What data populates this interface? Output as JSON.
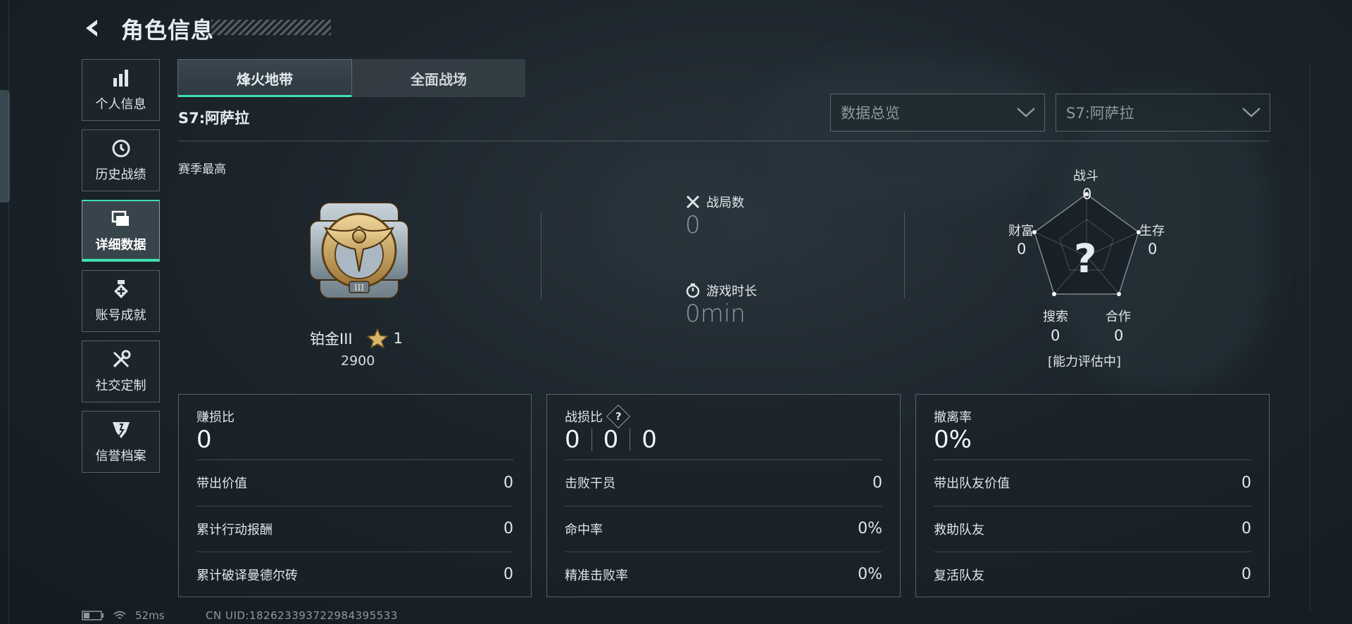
{
  "header": {
    "title": "角色信息"
  },
  "sidebar": {
    "items": [
      {
        "label": "个人信息",
        "icon": "bar-chart-icon",
        "active": false
      },
      {
        "label": "历史战绩",
        "icon": "history-clock-icon",
        "active": false
      },
      {
        "label": "详细数据",
        "icon": "folder-stack-icon",
        "active": true
      },
      {
        "label": "账号成就",
        "icon": "medal-icon",
        "active": false
      },
      {
        "label": "社交定制",
        "icon": "tools-icon",
        "active": false
      },
      {
        "label": "信誉档案",
        "icon": "shield-emblem-icon",
        "active": false
      }
    ]
  },
  "tabs": [
    {
      "label": "烽火地带",
      "active": true
    },
    {
      "label": "全面战场",
      "active": false
    }
  ],
  "season_title": "S7:阿萨拉",
  "filters": {
    "view": {
      "value": "数据总览"
    },
    "season": {
      "value": "S7:阿萨拉"
    }
  },
  "season_best": {
    "label": "赛季最高",
    "rank_name": "铂金III",
    "stars": "1",
    "points": "2900"
  },
  "match_stats": {
    "matches": {
      "label": "战局数",
      "value": "0"
    },
    "playtime": {
      "label": "游戏时长",
      "value": "0min"
    }
  },
  "radar": {
    "combat": {
      "label": "战斗",
      "value": "0"
    },
    "survival": {
      "label": "生存",
      "value": "0"
    },
    "teamwork": {
      "label": "合作",
      "value": "0"
    },
    "search": {
      "label": "搜索",
      "value": "0"
    },
    "wealth": {
      "label": "财富",
      "value": "0"
    },
    "center_mark": "?",
    "status": "[能力评估中]"
  },
  "panels": {
    "profit": {
      "title": "赚损比",
      "value": "0",
      "rows": [
        {
          "label": "带出价值",
          "value": "0"
        },
        {
          "label": "累计行动报酬",
          "value": "0"
        },
        {
          "label": "累计破译曼德尔砖",
          "value": "0"
        }
      ]
    },
    "combat": {
      "title": "战损比",
      "help": "?",
      "values": [
        "0",
        "0",
        "0"
      ],
      "rows": [
        {
          "label": "击败干员",
          "value": "0"
        },
        {
          "label": "命中率",
          "value": "0%"
        },
        {
          "label": "精准击败率",
          "value": "0%"
        }
      ]
    },
    "extract": {
      "title": "撤离率",
      "value": "0%",
      "rows": [
        {
          "label": "带出队友价值",
          "value": "0"
        },
        {
          "label": "救助队友",
          "value": "0"
        },
        {
          "label": "复活队友",
          "value": "0"
        }
      ]
    }
  },
  "status_bar": {
    "ping": "52ms",
    "uid": "CN UID:1826233937229843955​33"
  },
  "colors": {
    "accent": "#3fe0b0",
    "background": "#1c252c"
  }
}
